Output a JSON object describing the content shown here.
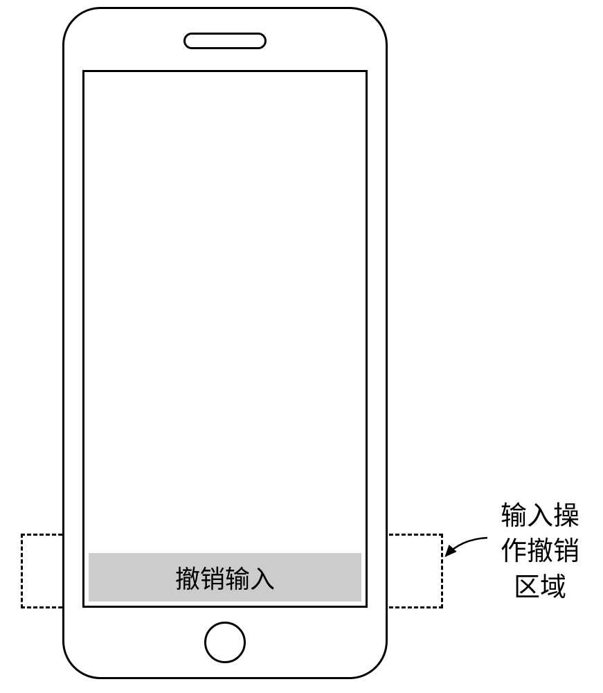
{
  "phone": {
    "undo_bar_label": "撤销输入"
  },
  "annotation": {
    "line1": "输入操",
    "line2": "作撤销",
    "line3": "区域"
  }
}
